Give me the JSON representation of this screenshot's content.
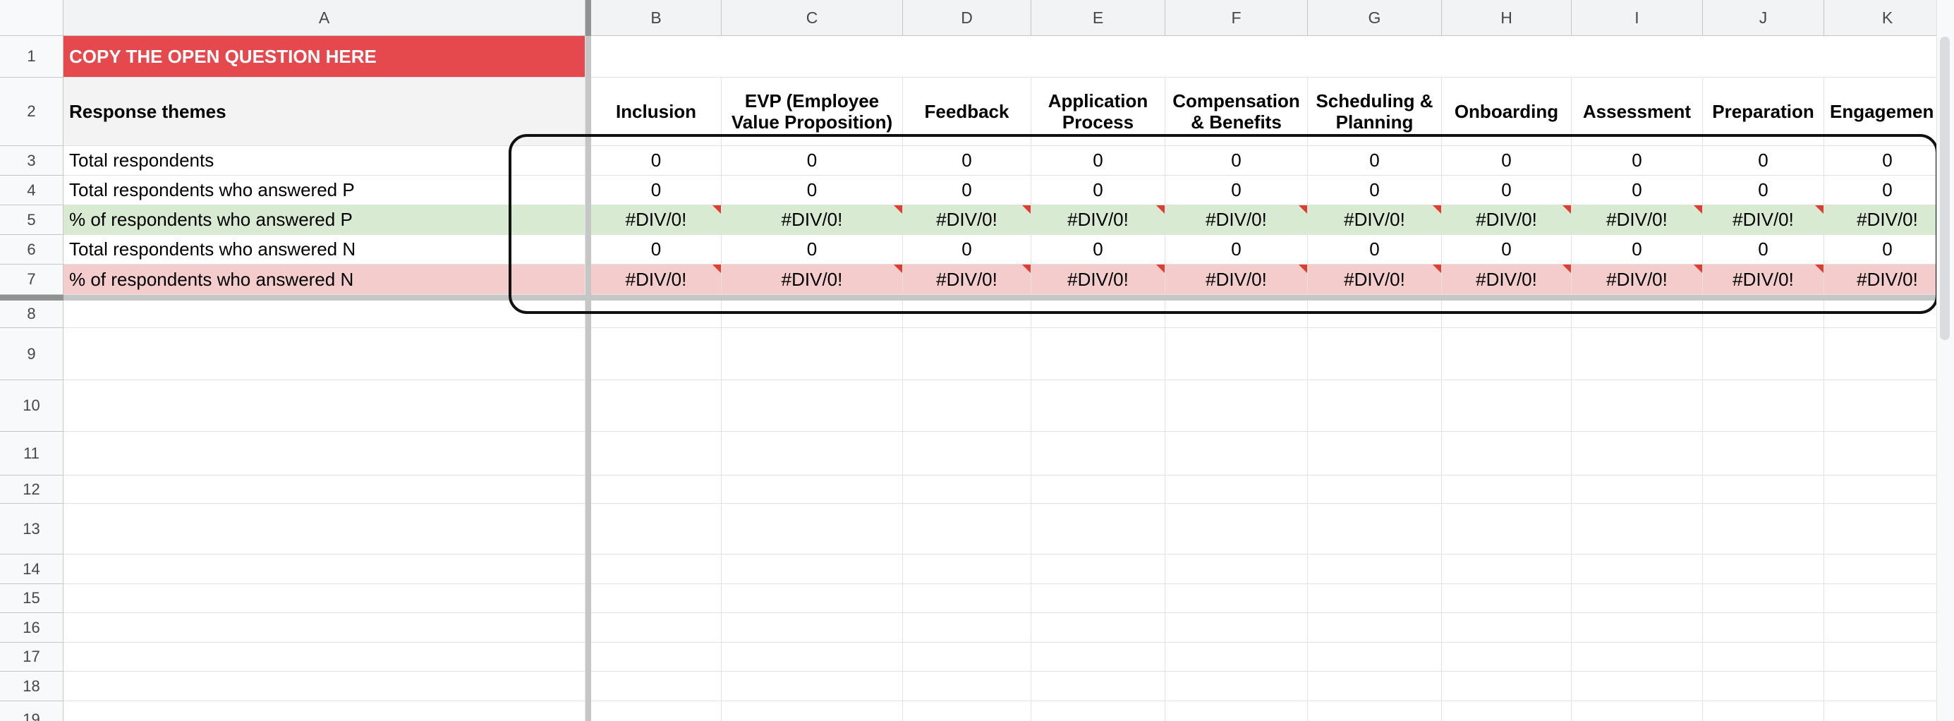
{
  "columns": [
    "A",
    "B",
    "C",
    "D",
    "E",
    "F",
    "G",
    "H",
    "I",
    "J",
    "K"
  ],
  "rows": [
    "1",
    "2",
    "3",
    "4",
    "5",
    "6",
    "7",
    "8",
    "9",
    "10",
    "11",
    "12",
    "13",
    "14",
    "15",
    "16",
    "17",
    "18",
    "19"
  ],
  "sheet": {
    "title_cell": "COPY THE OPEN QUESTION HERE",
    "themes_label": "Response themes",
    "themes": [
      {
        "line1": "Inclusion",
        "line2": ""
      },
      {
        "line1": "EVP (Employee",
        "line2": "Value Proposition)"
      },
      {
        "line1": "Feedback",
        "line2": ""
      },
      {
        "line1": "Application",
        "line2": "Process"
      },
      {
        "line1": "Compensation",
        "line2": "& Benefits"
      },
      {
        "line1": "Scheduling &",
        "line2": "Planning"
      },
      {
        "line1": "Onboarding",
        "line2": ""
      },
      {
        "line1": "Assessment",
        "line2": ""
      },
      {
        "line1": "Preparation",
        "line2": ""
      },
      {
        "line1": "Engagemen",
        "line2": ""
      }
    ],
    "metrics": [
      {
        "label": "Total respondents",
        "values": [
          "0",
          "0",
          "0",
          "0",
          "0",
          "0",
          "0",
          "0",
          "0",
          "0"
        ],
        "style": "plain"
      },
      {
        "label": "Total respondents who answered P",
        "values": [
          "0",
          "0",
          "0",
          "0",
          "0",
          "0",
          "0",
          "0",
          "0",
          "0"
        ],
        "style": "plain"
      },
      {
        "label": "% of respondents who answered P",
        "values": [
          "#DIV/0!",
          "#DIV/0!",
          "#DIV/0!",
          "#DIV/0!",
          "#DIV/0!",
          "#DIV/0!",
          "#DIV/0!",
          "#DIV/0!",
          "#DIV/0!",
          "#DIV/0!"
        ],
        "style": "green"
      },
      {
        "label": "Total respondents who answered N",
        "values": [
          "0",
          "0",
          "0",
          "0",
          "0",
          "0",
          "0",
          "0",
          "0",
          "0"
        ],
        "style": "plain"
      },
      {
        "label": "% of respondents who answered N",
        "values": [
          "#DIV/0!",
          "#DIV/0!",
          "#DIV/0!",
          "#DIV/0!",
          "#DIV/0!",
          "#DIV/0!",
          "#DIV/0!",
          "#DIV/0!",
          "#DIV/0!",
          "#DIV/0!"
        ],
        "style": "red"
      }
    ]
  },
  "colors": {
    "title_bg": "#e5484d",
    "green_row": "#d9ead3",
    "red_row": "#f4cccc",
    "error_flag": "#e03c31"
  }
}
